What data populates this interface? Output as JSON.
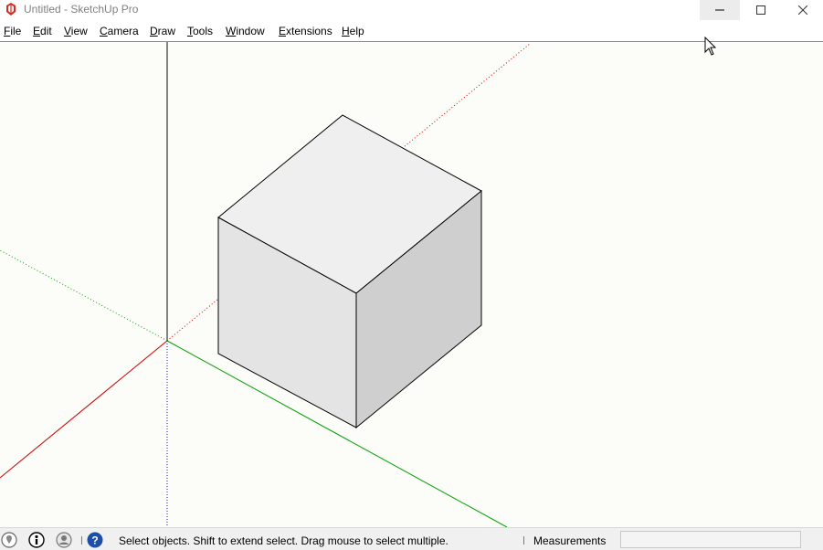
{
  "window": {
    "title": "Untitled - SketchUp Pro",
    "app_icon": "sketchup-icon",
    "controls": {
      "minimize": "minimize-icon",
      "maximize": "maximize-icon",
      "close": "close-icon"
    }
  },
  "menu": {
    "items": [
      {
        "first": "F",
        "rest": "ile"
      },
      {
        "first": "E",
        "rest": "dit"
      },
      {
        "first": "V",
        "rest": "iew"
      },
      {
        "first": "C",
        "rest": "amera"
      },
      {
        "first": "D",
        "rest": "raw"
      },
      {
        "first": "T",
        "rest": "ools"
      },
      {
        "first": "W",
        "rest": "indow"
      },
      {
        "first": "E",
        "rest": "xtensions"
      },
      {
        "first": "H",
        "rest": "elp"
      }
    ]
  },
  "viewport": {
    "background": "#fcfcf8",
    "axis_colors": {
      "red": "#cc0000",
      "green": "#00a000",
      "blue": "#0000aa"
    },
    "model": "cube",
    "face_colors": {
      "top": "#efefef",
      "left": "#e4e4e4",
      "right": "#cfcfcf"
    }
  },
  "statusbar": {
    "icons": [
      "geo-location-icon",
      "credits-icon",
      "user-account-icon"
    ],
    "help_icon": "help-icon",
    "status_text": "Select objects. Shift to extend select. Drag mouse to select multiple.",
    "measurements_label": "Measurements",
    "measurements_value": ""
  }
}
